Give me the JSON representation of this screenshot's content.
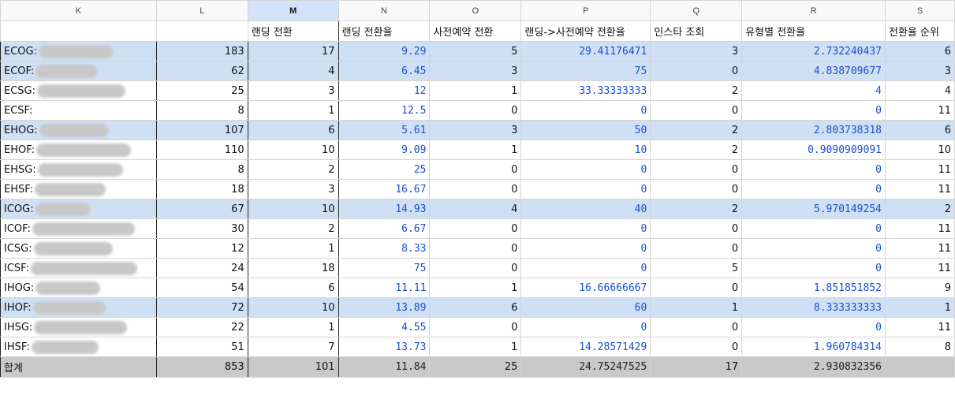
{
  "columns": [
    "K",
    "L",
    "M",
    "N",
    "O",
    "P",
    "Q",
    "R",
    "S"
  ],
  "headers": {
    "M": "랜딩 전환",
    "N": "랜딩 전환율",
    "O": "사전예약 전환",
    "P": "랜딩->사전예약 전환율",
    "Q": "인스타 조회",
    "R": "유형별 전환율",
    "S": "전환율 순위"
  },
  "rows": [
    {
      "k": "ECOG:",
      "l": "183",
      "m": "17",
      "n": "9.29",
      "o": "5",
      "p": "29.41176471",
      "q": "3",
      "r": "2.732240437",
      "s": "6",
      "hl": true
    },
    {
      "k": "ECOF:",
      "l": "62",
      "m": "4",
      "n": "6.45",
      "o": "3",
      "p": "75",
      "q": "0",
      "r": "4.838709677",
      "s": "3",
      "hl": true
    },
    {
      "k": "ECSG:",
      "l": "25",
      "m": "3",
      "n": "12",
      "o": "1",
      "p": "33.33333333",
      "q": "2",
      "r": "4",
      "s": "4",
      "hl": false
    },
    {
      "k": "ECSF:",
      "l": "8",
      "m": "1",
      "n": "12.5",
      "o": "0",
      "p": "0",
      "q": "0",
      "r": "0",
      "s": "11",
      "hl": false
    },
    {
      "k": "EHOG:",
      "l": "107",
      "m": "6",
      "n": "5.61",
      "o": "3",
      "p": "50",
      "q": "2",
      "r": "2.803738318",
      "s": "6",
      "hl": true
    },
    {
      "k": "EHOF:",
      "l": "110",
      "m": "10",
      "n": "9.09",
      "o": "1",
      "p": "10",
      "q": "2",
      "r": "0.9090909091",
      "s": "10",
      "hl": false
    },
    {
      "k": "EHSG:",
      "l": "8",
      "m": "2",
      "n": "25",
      "o": "0",
      "p": "0",
      "q": "0",
      "r": "0",
      "s": "11",
      "hl": false
    },
    {
      "k": "EHSF:",
      "l": "18",
      "m": "3",
      "n": "16.67",
      "o": "0",
      "p": "0",
      "q": "0",
      "r": "0",
      "s": "11",
      "hl": false
    },
    {
      "k": "ICOG:",
      "l": "67",
      "m": "10",
      "n": "14.93",
      "o": "4",
      "p": "40",
      "q": "2",
      "r": "5.970149254",
      "s": "2",
      "hl": true
    },
    {
      "k": "ICOF:",
      "l": "30",
      "m": "2",
      "n": "6.67",
      "o": "0",
      "p": "0",
      "q": "0",
      "r": "0",
      "s": "11",
      "hl": false
    },
    {
      "k": "ICSG:",
      "l": "12",
      "m": "1",
      "n": "8.33",
      "o": "0",
      "p": "0",
      "q": "0",
      "r": "0",
      "s": "11",
      "hl": false
    },
    {
      "k": "ICSF:",
      "l": "24",
      "m": "18",
      "n": "75",
      "o": "0",
      "p": "0",
      "q": "5",
      "r": "0",
      "s": "11",
      "hl": false
    },
    {
      "k": "IHOG:",
      "l": "54",
      "m": "6",
      "n": "11.11",
      "o": "1",
      "p": "16.66666667",
      "q": "0",
      "r": "1.851851852",
      "s": "9",
      "hl": false
    },
    {
      "k": "IHOF:",
      "l": "72",
      "m": "10",
      "n": "13.89",
      "o": "6",
      "p": "60",
      "q": "1",
      "r": "8.333333333",
      "s": "1",
      "hl": true
    },
    {
      "k": "IHSG:",
      "l": "22",
      "m": "1",
      "n": "4.55",
      "o": "0",
      "p": "0",
      "q": "0",
      "r": "0",
      "s": "11",
      "hl": false
    },
    {
      "k": "IHSF:",
      "l": "51",
      "m": "7",
      "n": "13.73",
      "o": "1",
      "p": "14.28571429",
      "q": "0",
      "r": "1.960784314",
      "s": "8",
      "hl": false
    }
  ],
  "total": {
    "k": "합계",
    "l": "853",
    "m": "101",
    "n": "11.84",
    "o": "25",
    "p": "24.75247525",
    "q": "17",
    "r": "2.930832356",
    "s": ""
  },
  "colors": {
    "highlight_row": "#cfe0f5",
    "blue_text": "#1a4fd0",
    "selected_header": "#d3e2fb",
    "total_row": "#c9c9c9"
  }
}
